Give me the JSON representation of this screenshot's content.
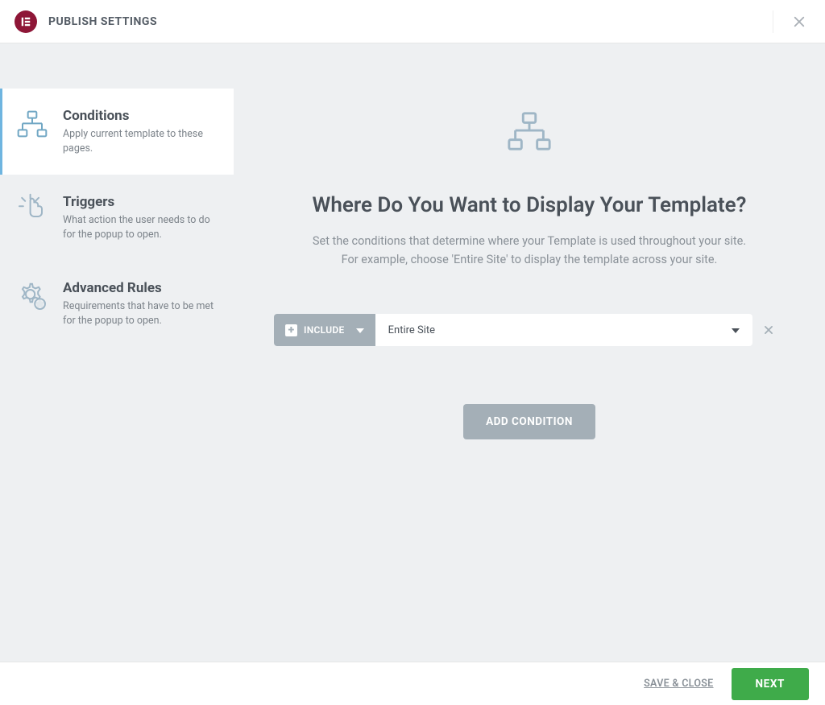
{
  "header": {
    "title": "PUBLISH SETTINGS"
  },
  "sidebar": {
    "items": [
      {
        "title": "Conditions",
        "desc": "Apply current template to these pages."
      },
      {
        "title": "Triggers",
        "desc": "What action the user needs to do for the popup to open."
      },
      {
        "title": "Advanced Rules",
        "desc": "Requirements that have to be met for the popup to open."
      }
    ]
  },
  "main": {
    "heading": "Where Do You Want to Display Your Template?",
    "subtext": "Set the conditions that determine where your Template is used throughout your site.\nFor example, choose 'Entire Site' to display the template across your site.",
    "condition": {
      "include_label": "INCLUDE",
      "selected_value": "Entire Site"
    },
    "add_button": "ADD CONDITION"
  },
  "footer": {
    "save_close": "SAVE & CLOSE",
    "next": "NEXT"
  }
}
